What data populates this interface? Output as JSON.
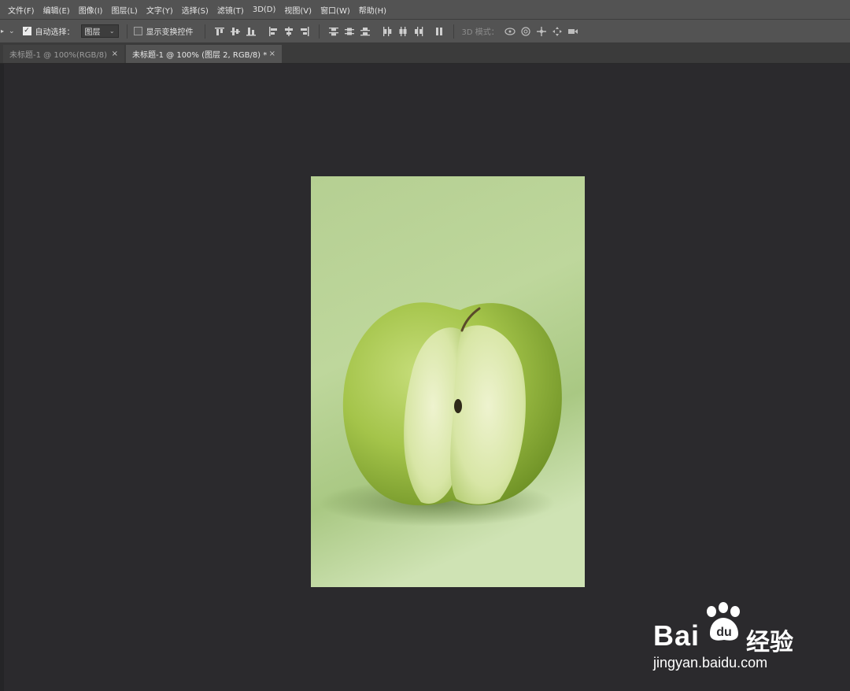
{
  "menu": {
    "items": [
      "文件(F)",
      "编辑(E)",
      "图像(I)",
      "图层(L)",
      "文字(Y)",
      "选择(S)",
      "滤镜(T)",
      "3D(D)",
      "视图(V)",
      "窗口(W)",
      "帮助(H)"
    ]
  },
  "options_bar": {
    "auto_select_label": "自动选择：",
    "auto_select_checked": true,
    "auto_select_target": "图层",
    "show_transform_label": "显示变换控件",
    "show_transform_checked": false,
    "mode_3d_label": "3D 模式："
  },
  "tabs": [
    {
      "label": "未标题-1 @ 100%(RGB/8)",
      "active": false
    },
    {
      "label": "未标题-1 @ 100% (图层 2, RGB/8) *",
      "active": true
    }
  ],
  "watermark": {
    "brand": "Bai",
    "brand_tail": "u",
    "cn": "经验",
    "url": "jingyan.baidu.com"
  },
  "colors": {
    "menubar": "#535353",
    "canvas_bg": "#2b2a2d",
    "apple_green": "#9cc43c"
  }
}
